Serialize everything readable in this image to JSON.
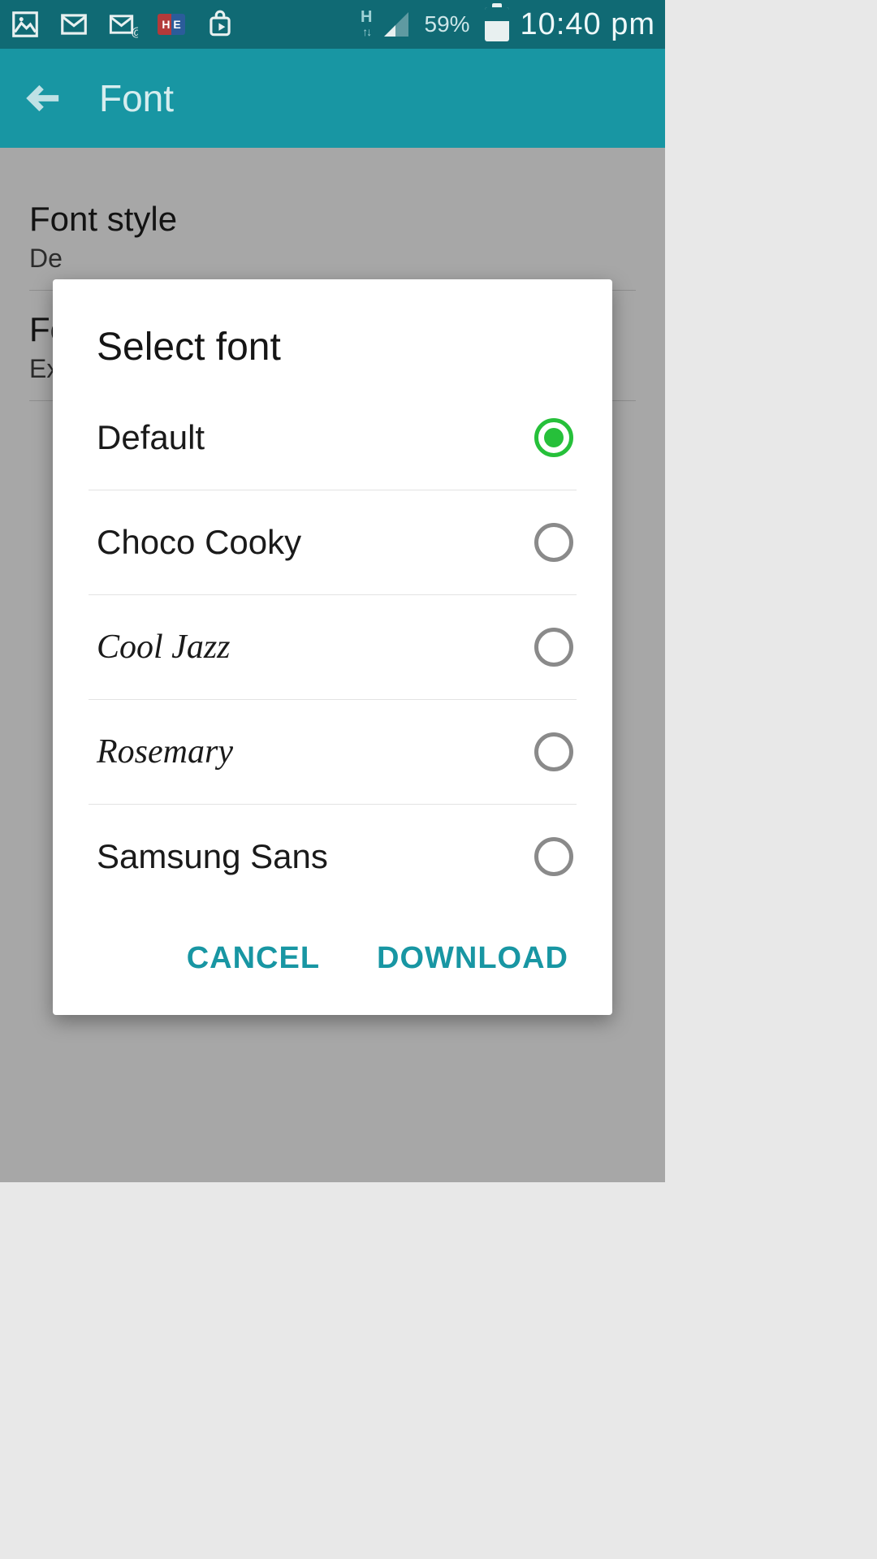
{
  "status_bar": {
    "icons": {
      "gallery": "gallery-icon",
      "gmail": "gmail-icon",
      "message": "message-icon",
      "he": "H E",
      "play": "play-store-icon"
    },
    "network_letter": "H",
    "network_arrows": "↑↓",
    "battery_pct": "59%",
    "clock": "10:40 pm"
  },
  "action_bar": {
    "title": "Font"
  },
  "page": {
    "font_style": {
      "title": "Font style",
      "value": "De"
    },
    "font_size": {
      "title": "Fo",
      "value": "Ex"
    }
  },
  "dialog": {
    "title": "Select font",
    "options": {
      "default": "Default",
      "choco": "Choco Cooky",
      "cool": "Cool Jazz",
      "rosemary": "Rosemary",
      "samsung": "Samsung Sans"
    },
    "cancel": "CANCEL",
    "download": "DOWNLOAD"
  },
  "colors": {
    "teal_dark": "#106a74",
    "teal": "#1896a3",
    "accent_green": "#26c03a"
  }
}
